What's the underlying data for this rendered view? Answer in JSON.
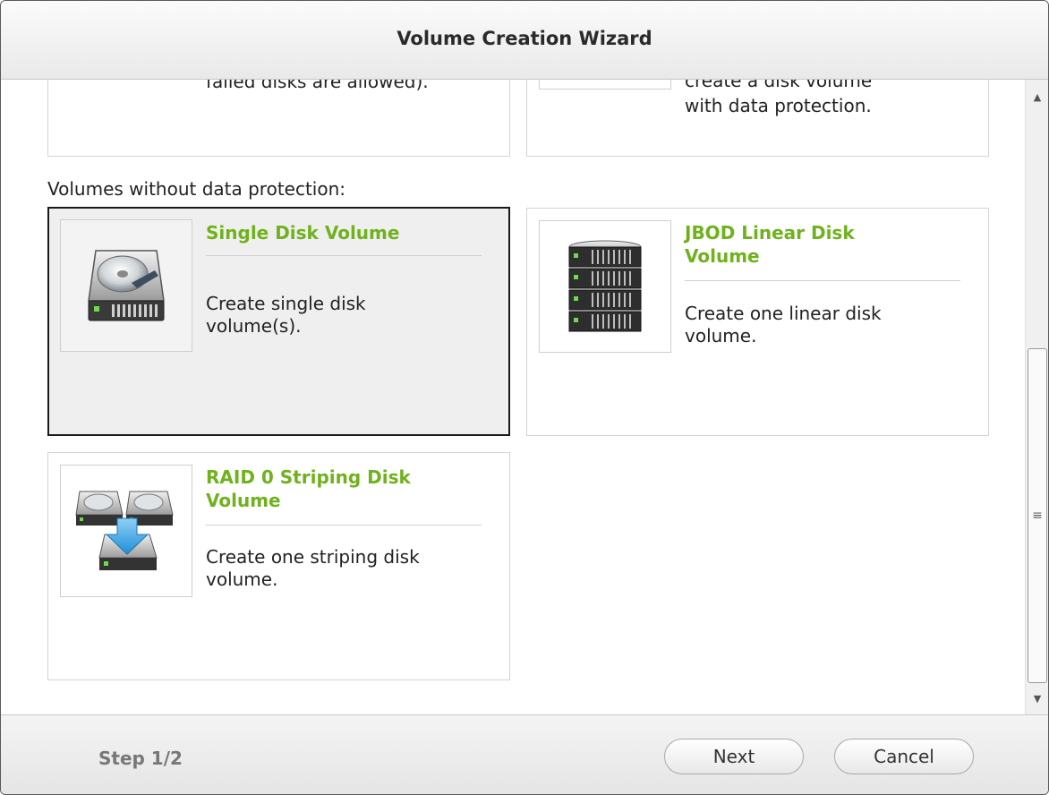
{
  "window": {
    "title": "Volume Creation Wizard"
  },
  "content": {
    "top_cards": {
      "left_partial_text": "failed disks are allowed).",
      "right_partial_text_1": "create a disk volume",
      "right_partial_text_2": "with data protection."
    },
    "section_label": "Volumes without data protection:",
    "options": [
      {
        "title": "Single Disk Volume",
        "description": "Create single disk volume(s).",
        "icon": "single-disk-icon",
        "selected": true
      },
      {
        "title": "JBOD Linear Disk Volume",
        "description": "Create one linear disk volume.",
        "icon": "jbod-stack-icon",
        "selected": false
      },
      {
        "title": "RAID 0 Striping Disk Volume",
        "description": "Create one striping disk volume.",
        "icon": "raid0-striping-icon",
        "selected": false
      }
    ]
  },
  "footer": {
    "step_label": "Step 1/2",
    "next_label": "Next",
    "cancel_label": "Cancel"
  },
  "colors": {
    "accent_green": "#6fb21c",
    "selected_border": "#1a1a1a"
  }
}
